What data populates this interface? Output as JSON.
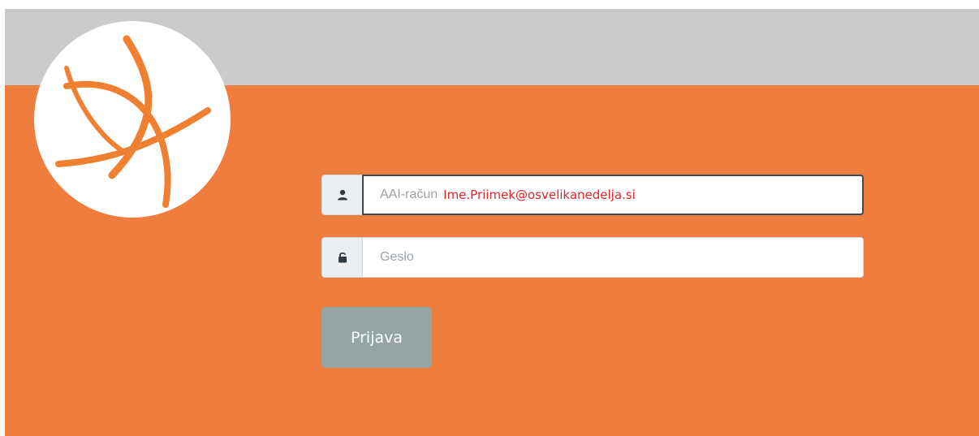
{
  "colors": {
    "header_gray": "#cbcbcb",
    "brand_orange": "#ef7d3e",
    "logo_orange": "#ef7f31",
    "button_gray": "#95a5a6",
    "typed_text_red": "#e2252b"
  },
  "logo": {
    "icon": "curved-arc-star-logo"
  },
  "login": {
    "username": {
      "icon": "user-icon",
      "placeholder": "AAI-račun",
      "value": "Ime.Priimek@osvelikanedelja.si"
    },
    "password": {
      "icon": "unlock-icon",
      "placeholder": "Geslo",
      "value": ""
    },
    "submit_label": "Prijava"
  }
}
